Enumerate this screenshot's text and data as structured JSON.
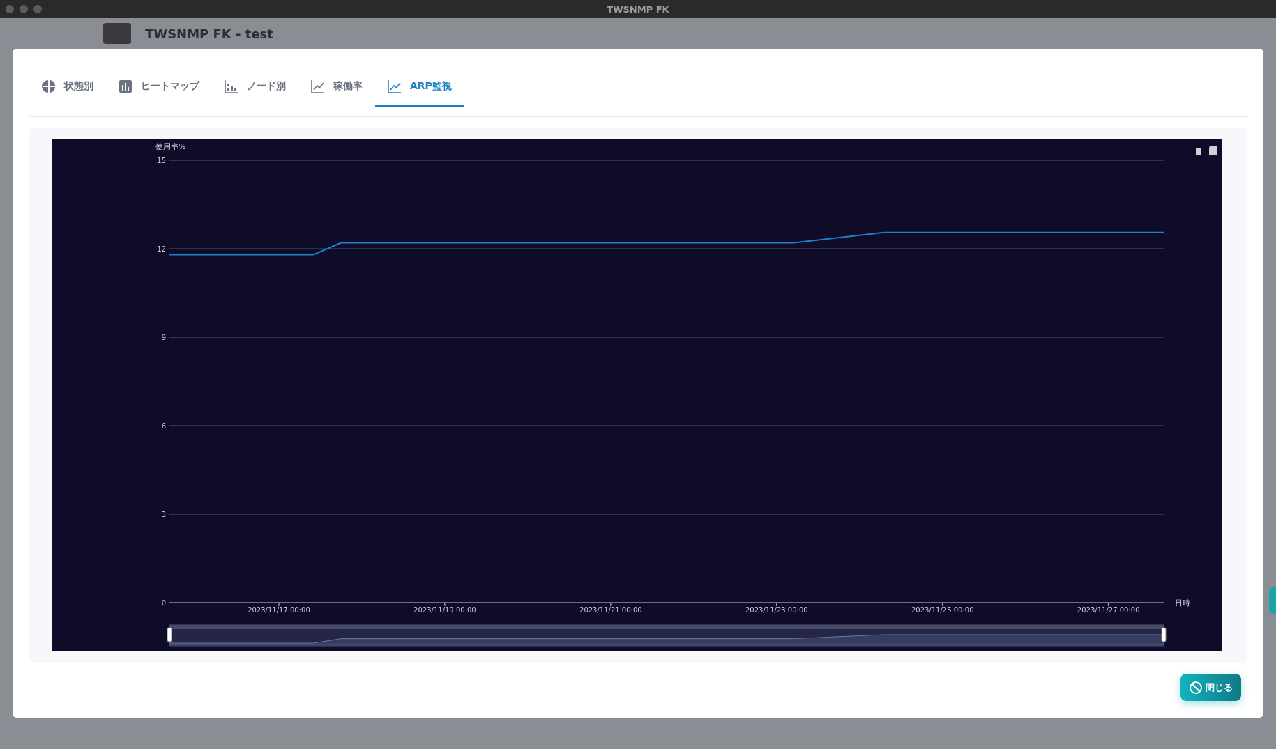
{
  "window": {
    "title": "TWSNMP FK"
  },
  "app_header": {
    "title": "TWSNMP FK - test"
  },
  "tabs": [
    {
      "label": "状態別",
      "kind": "pie",
      "selected": false
    },
    {
      "label": "ヒートマップ",
      "kind": "bars",
      "selected": false
    },
    {
      "label": "ノード別",
      "kind": "stack",
      "selected": false
    },
    {
      "label": "稼働率",
      "kind": "line",
      "selected": false
    },
    {
      "label": "ARP監視",
      "kind": "line",
      "selected": true
    }
  ],
  "chart": {
    "chart_data": {
      "type": "line",
      "ylabel": "使用率%",
      "xlabel": "日時",
      "x": [
        "2023-11-15T16:20",
        "2023-11-17T10:00",
        "2023-11-17T18:00",
        "2023-11-23T05:00",
        "2023-11-24T07:00",
        "2023-11-27T16:00"
      ],
      "series": [
        {
          "color": "#1f7fc9",
          "values": [
            11.8,
            11.8,
            12.2,
            12.2,
            12.55,
            12.55
          ]
        }
      ],
      "xlim": [
        "2023-11-15T16:20",
        "2023-11-27T16:00"
      ],
      "ylim": [
        0,
        15
      ],
      "xticks": [
        {
          "value": "2023-11-17T00:00",
          "label": "2023/11/17 00:00"
        },
        {
          "value": "2023-11-19T00:00",
          "label": "2023/11/19 00:00"
        },
        {
          "value": "2023-11-21T00:00",
          "label": "2023/11/21 00:00"
        },
        {
          "value": "2023-11-23T00:00",
          "label": "2023/11/23 00:00"
        },
        {
          "value": "2023-11-25T00:00",
          "label": "2023/11/25 00:00"
        },
        {
          "value": "2023-11-27T00:00",
          "label": "2023/11/27 00:00"
        }
      ],
      "yticks": [
        0,
        3,
        6,
        9,
        12,
        15
      ],
      "grid": true
    }
  },
  "close_button": {
    "label": "閉じる"
  }
}
